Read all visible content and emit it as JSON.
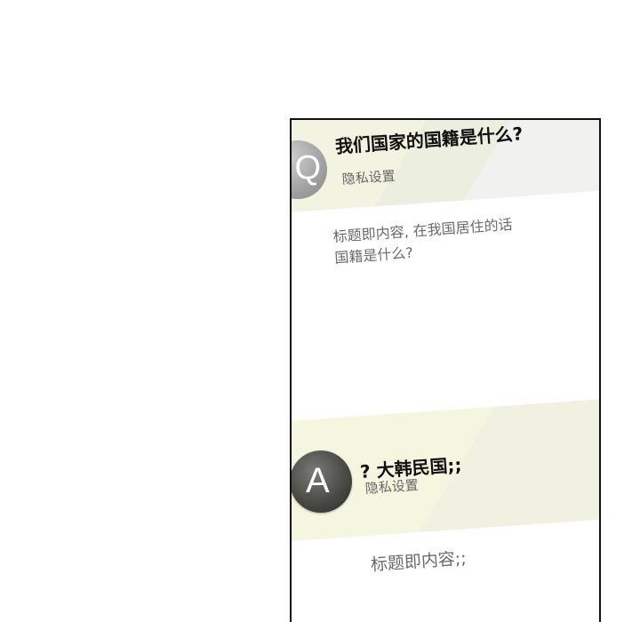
{
  "question": {
    "badge_letter": "Q",
    "title": "我们国家的国籍是什么?",
    "privacy_label": "隐私设置",
    "body_line1": "标题即内容, 在我国居住的话",
    "body_line2": "国籍是什么?"
  },
  "answer": {
    "badge_letter": "A",
    "title": "? 大韩民国;;",
    "privacy_label": "隐私设置",
    "body": "标题即内容;;"
  },
  "colors": {
    "panel_border": "#111111",
    "question_band": "#f3f3e2",
    "answer_band": "#f5f6e0",
    "question_badge": "#9a9a9a",
    "answer_badge": "#3a3a36"
  }
}
